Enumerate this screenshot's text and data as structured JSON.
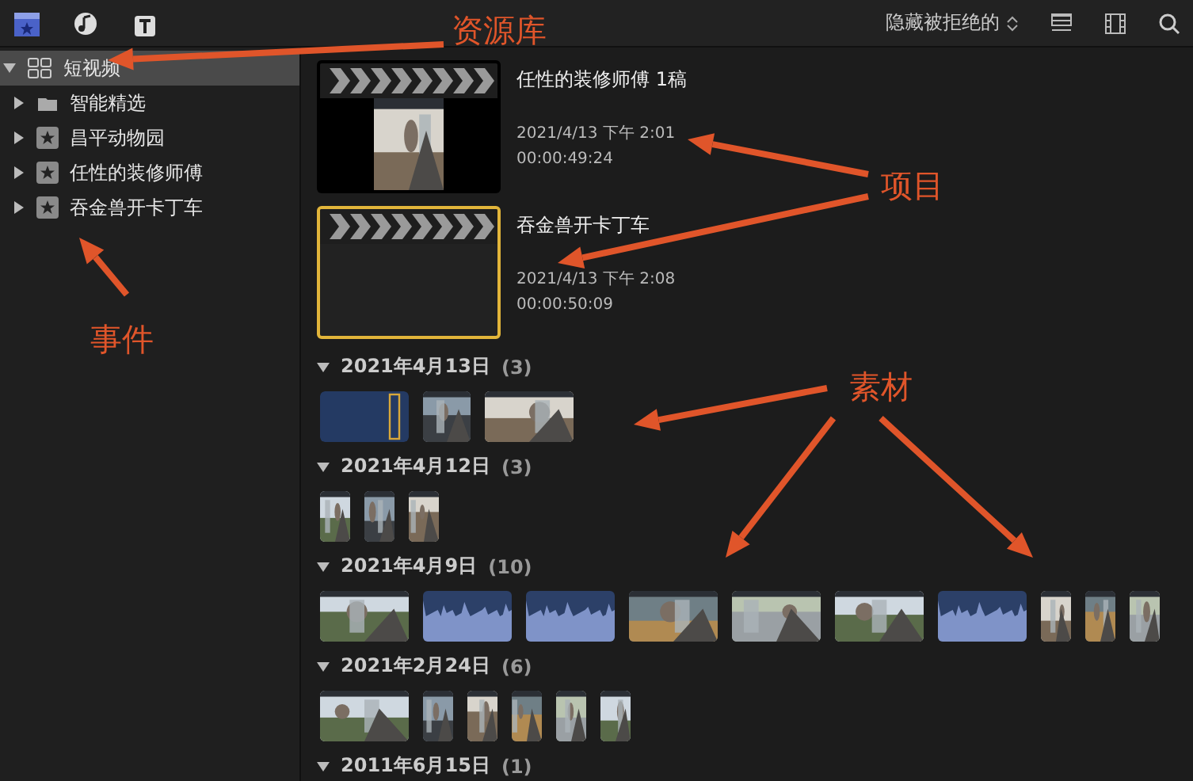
{
  "toolbar": {
    "filter": "隐藏被拒绝的"
  },
  "sidebar": {
    "library": {
      "label": "短视频",
      "expanded": true,
      "selected": true,
      "children": [
        {
          "label": "智能精选",
          "kind": "folder",
          "expanded": false
        },
        {
          "label": "昌平动物园",
          "kind": "event",
          "expanded": false
        },
        {
          "label": "任性的装修师傅",
          "kind": "event",
          "expanded": false
        },
        {
          "label": "吞金兽开卡丁车",
          "kind": "event",
          "expanded": false
        }
      ]
    }
  },
  "projects": [
    {
      "title": "任性的装修师傅 1稿",
      "date": "2021/4/13 下午 2:01",
      "duration": "00:00:49:24",
      "selected": false,
      "kind": "picture"
    },
    {
      "title": "吞金兽开卡丁车",
      "date": "2021/4/13 下午 2:08",
      "duration": "00:00:50:09",
      "selected": true,
      "kind": "empty"
    }
  ],
  "groups": [
    {
      "date": "2021年4月13日",
      "count": "(3)",
      "expanded": true,
      "clips": [
        {
          "kind": "solid"
        },
        {
          "kind": "square"
        },
        {
          "kind": "video"
        }
      ]
    },
    {
      "date": "2021年4月12日",
      "count": "(3)",
      "expanded": true,
      "clips": [
        {
          "kind": "portrait"
        },
        {
          "kind": "portrait"
        },
        {
          "kind": "portrait"
        }
      ]
    },
    {
      "date": "2021年4月9日",
      "count": "(10)",
      "expanded": true,
      "clips": [
        {
          "kind": "video"
        },
        {
          "kind": "audio"
        },
        {
          "kind": "audio"
        },
        {
          "kind": "video"
        },
        {
          "kind": "video"
        },
        {
          "kind": "video"
        },
        {
          "kind": "audio"
        },
        {
          "kind": "portrait"
        },
        {
          "kind": "portrait"
        },
        {
          "kind": "portrait"
        }
      ]
    },
    {
      "date": "2021年2月24日",
      "count": "(6)",
      "expanded": true,
      "clips": [
        {
          "kind": "video"
        },
        {
          "kind": "portrait"
        },
        {
          "kind": "portrait"
        },
        {
          "kind": "portrait"
        },
        {
          "kind": "portrait"
        },
        {
          "kind": "portrait"
        }
      ]
    },
    {
      "date": "2011年6月15日",
      "count": "(1)",
      "expanded": true
    }
  ],
  "annotations": [
    {
      "label": "资源库"
    },
    {
      "label": "项目"
    },
    {
      "label": "事件"
    },
    {
      "label": "素材"
    }
  ]
}
